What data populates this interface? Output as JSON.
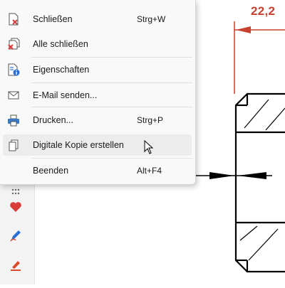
{
  "menu": {
    "items": [
      {
        "label": "Schließen",
        "shortcut": "Strg+W",
        "icon": "close-document-icon"
      },
      {
        "label": "Alle schließen",
        "shortcut": "",
        "icon": "close-all-icon"
      },
      {
        "label": "Eigenschaften",
        "shortcut": "",
        "icon": "properties-icon"
      },
      {
        "label": "E-Mail senden...",
        "shortcut": "",
        "icon": "mail-icon"
      },
      {
        "label": "Drucken...",
        "shortcut": "Strg+P",
        "icon": "printer-icon"
      },
      {
        "label": "Digitale Kopie erstellen",
        "shortcut": "",
        "icon": "copy-icon",
        "hovered": true
      },
      {
        "label": "Beenden",
        "shortcut": "Alt+F4",
        "icon": ""
      }
    ]
  },
  "drawing": {
    "dimension_label": "22,2 ",
    "dimension_color": "#c8412e",
    "line_color": "#000000"
  },
  "toolbar": {
    "tools": [
      "dots-icon",
      "heart-icon",
      "pen-icon",
      "highlighter-icon"
    ],
    "heart_color": "#d93a3a",
    "pen_color": "#2a6fd6",
    "highlighter_color": "#d94a2a"
  }
}
